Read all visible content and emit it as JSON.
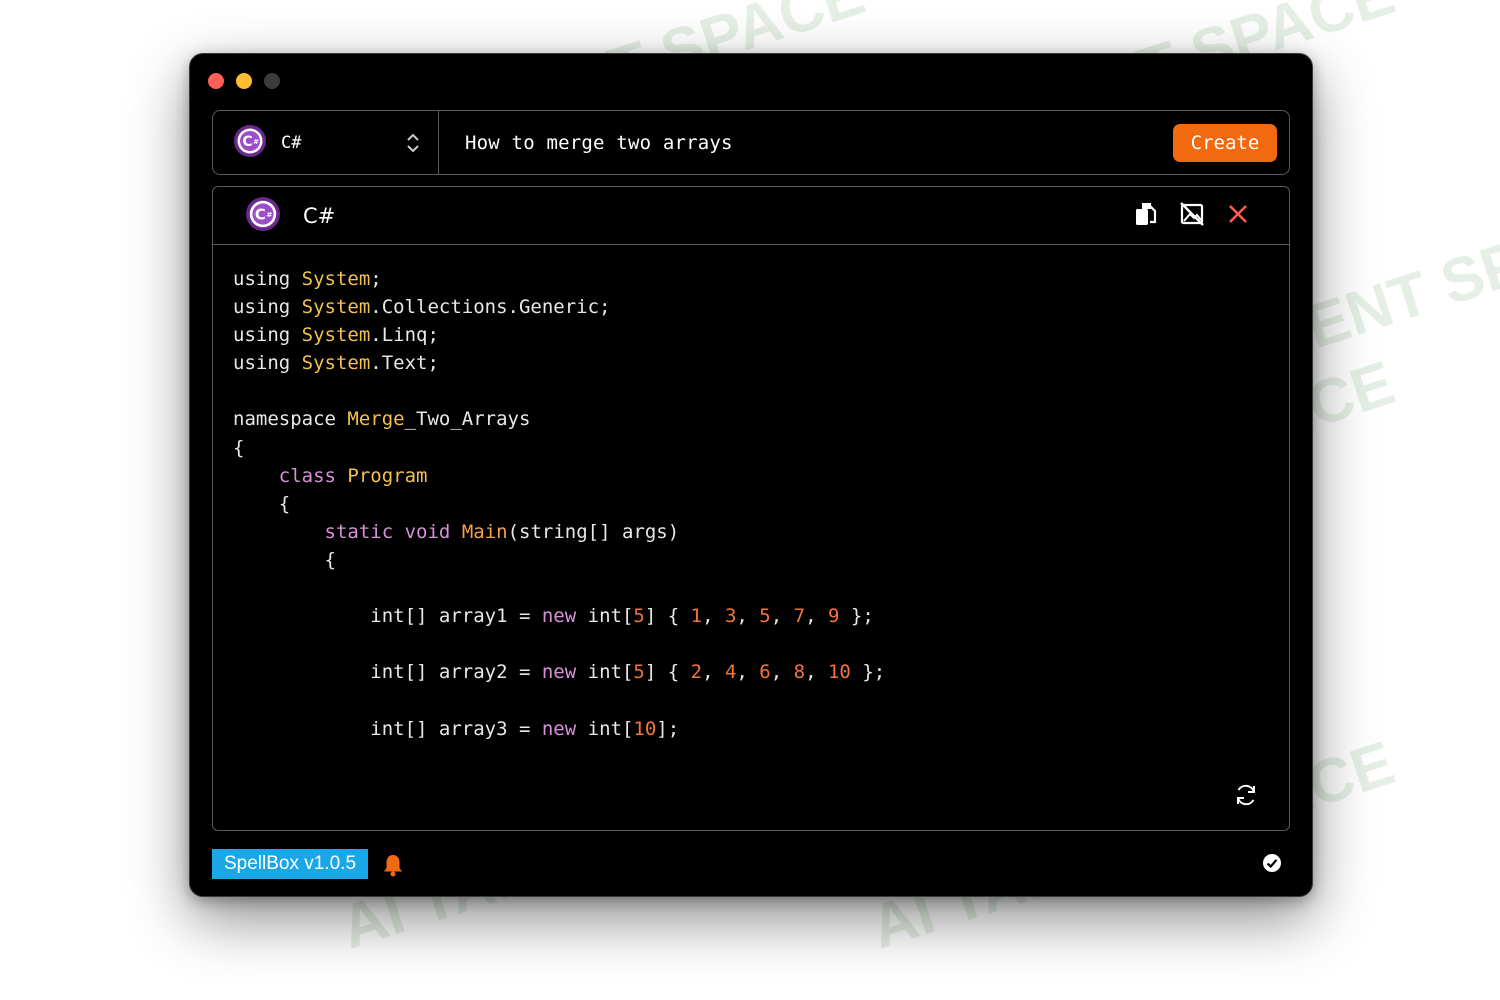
{
  "window": {
    "traffic_lights": [
      "close",
      "minimize",
      "zoom"
    ]
  },
  "toolbar": {
    "language": "C#",
    "query": "How to merge two arrays",
    "create_label": "Create"
  },
  "panel": {
    "title": "C#",
    "icons": [
      "copy-icon",
      "no-image-icon",
      "close-icon",
      "refresh-icon"
    ]
  },
  "code": {
    "lines": [
      "using System;",
      "using System.Collections.Generic;",
      "using System.Linq;",
      "using System.Text;",
      "",
      "namespace Merge_Two_Arrays",
      "{",
      "    class Program",
      "    {",
      "        static void Main(string[] args)",
      "        {",
      "",
      "            int[] array1 = new int[5] { 1, 3, 5, 7, 9 };",
      "",
      "            int[] array2 = new int[5] { 2, 4, 6, 8, 10 };",
      "",
      "            int[] array3 = new int[10];"
    ]
  },
  "status": {
    "version": "SpellBox v1.0.5"
  },
  "watermark": "AI TALENT SPACE",
  "colors": {
    "accent": "#f26a0f",
    "version_badge": "#1aa7e8",
    "close_icon": "#ff5a4e",
    "keyword_yellow": "#f2c14e",
    "keyword_purple": "#d792d9",
    "number": "#f2743b"
  }
}
